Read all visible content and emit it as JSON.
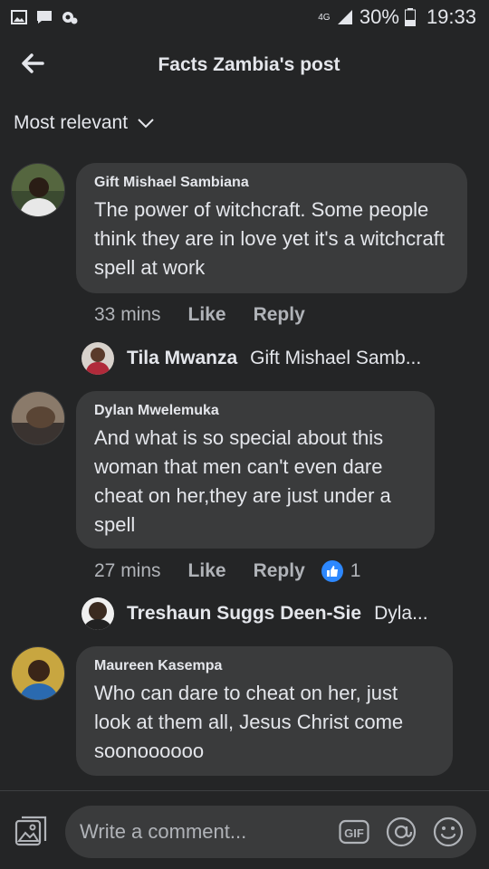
{
  "status_bar": {
    "network": "4G",
    "battery": "30%",
    "time": "19:33"
  },
  "header": {
    "title": "Facts Zambia's post"
  },
  "sort": {
    "label": "Most relevant"
  },
  "comments": [
    {
      "author": "Gift Mishael Sambiana",
      "text": "The power of witchcraft. Some people think they are in love yet it's a witchcraft spell at work",
      "time": "33 mins",
      "like_label": "Like",
      "reply_label": "Reply",
      "reply_preview": {
        "name": "Tila Mwanza",
        "snippet": "Gift Mishael Samb..."
      }
    },
    {
      "author": "Dylan Mwelemuka",
      "text": "And what is so special about this woman that men can't even dare cheat on her,they are just under a spell",
      "time": "27 mins",
      "like_label": "Like",
      "reply_label": "Reply",
      "reaction_count": "1",
      "reply_preview": {
        "name": "Treshaun Suggs Deen-Sie",
        "snippet": "Dyla..."
      }
    },
    {
      "author": "Maureen Kasempa",
      "text": "Who can dare to cheat on her, just look at them all, Jesus Christ come soonoooooo"
    }
  ],
  "composer": {
    "placeholder": "Write a comment...",
    "gif_label": "GIF"
  },
  "colors": {
    "background": "#242526",
    "bubble": "#3a3b3c",
    "text": "#e4e6eb",
    "secondary_text": "#b0b3b8",
    "like_blue": "#2d88ff"
  }
}
